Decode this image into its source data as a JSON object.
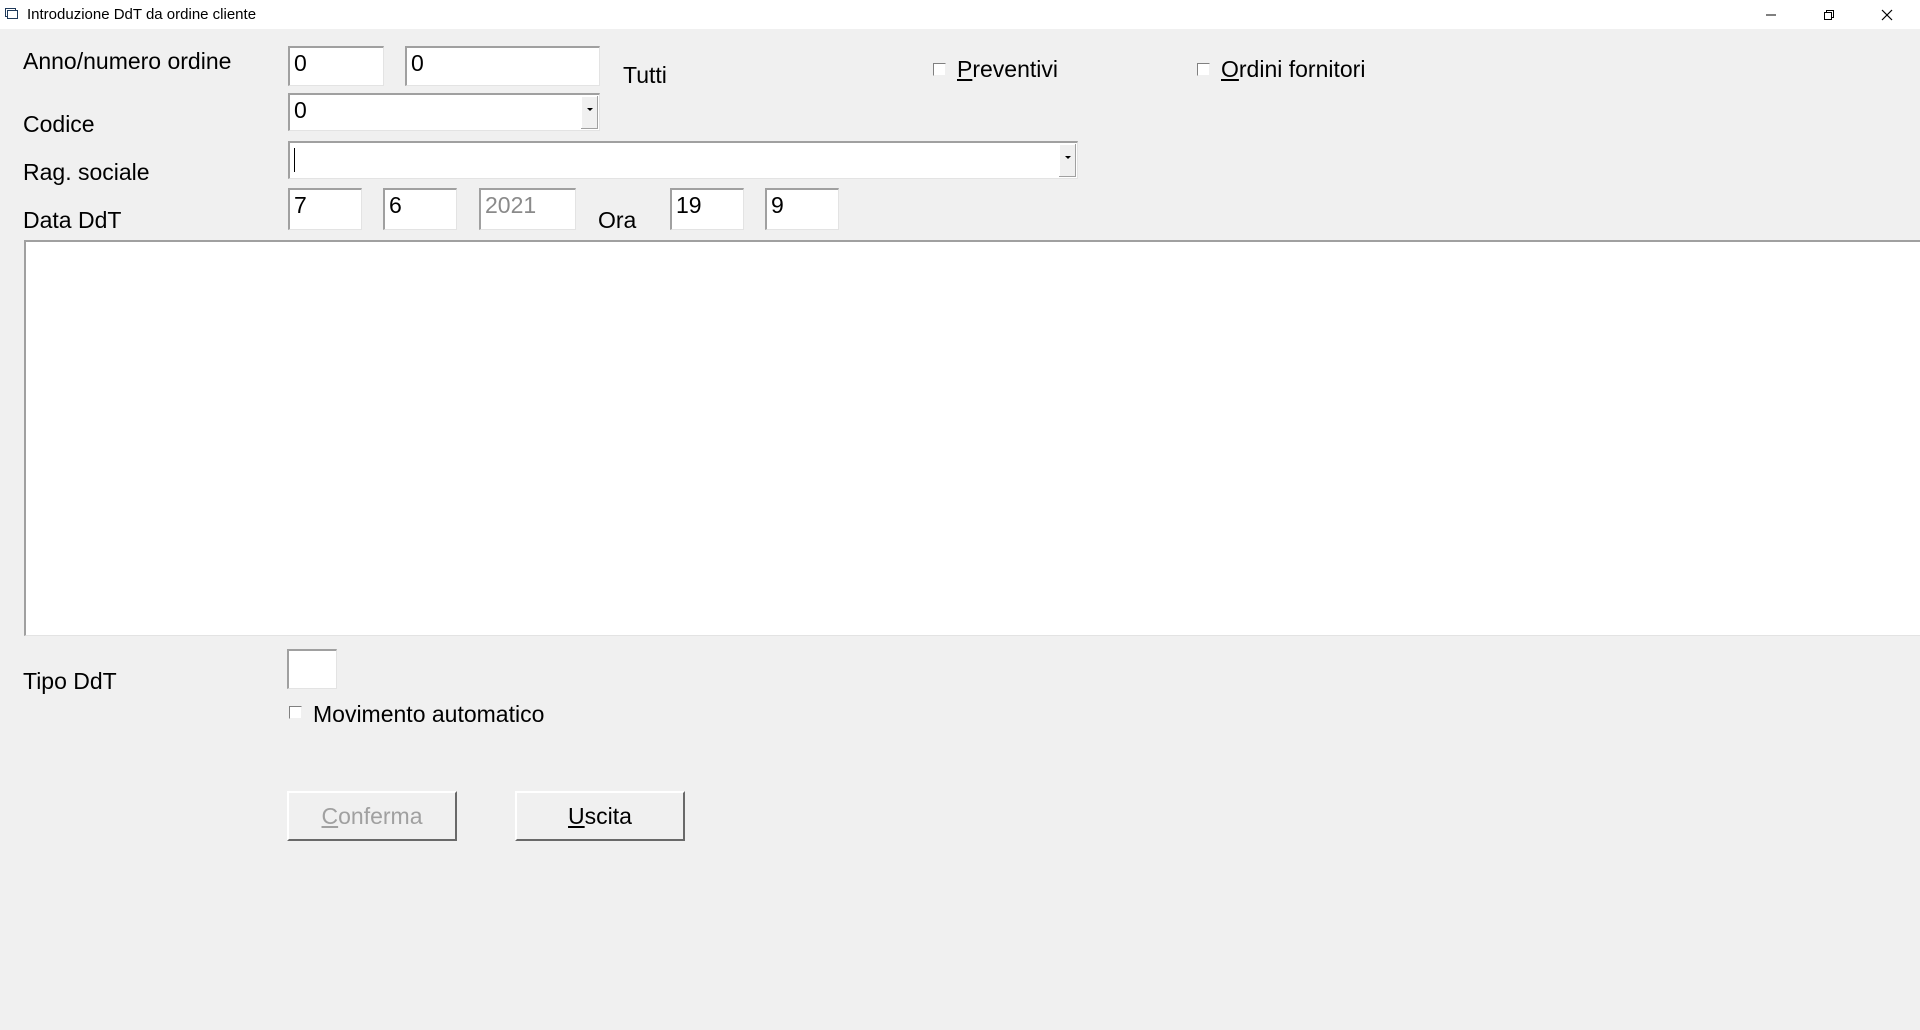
{
  "window": {
    "title": "Introduzione DdT da ordine cliente",
    "minimize": "minimize",
    "restore": "restore",
    "close": "close"
  },
  "form": {
    "anno_numero_label": "Anno/numero ordine",
    "anno_value": "0",
    "numero_value": "0",
    "tutti_label": "Tutti",
    "preventivi": {
      "label_first": "P",
      "label_rest": "reventivi",
      "checked": false
    },
    "ordini_fornitori": {
      "label_first": "O",
      "label_rest": "rdini fornitori",
      "checked": false
    },
    "codice_label": "Codice",
    "codice_value": "0",
    "rag_sociale_label": "Rag. sociale",
    "rag_sociale_value": "",
    "data_ddt_label": "Data DdT",
    "data_day": "7",
    "data_month": "6",
    "data_year": "2021",
    "ora_label": "Ora",
    "ora_hour": "19",
    "ora_minute": "9",
    "tipo_ddt_label": "Tipo DdT",
    "tipo_ddt_value": "",
    "movimento_automatico": {
      "label": "Movimento automatico",
      "checked": false
    }
  },
  "buttons": {
    "conferma_first": "C",
    "conferma_rest": "onferma",
    "uscita_first": "U",
    "uscita_rest": "scita"
  }
}
